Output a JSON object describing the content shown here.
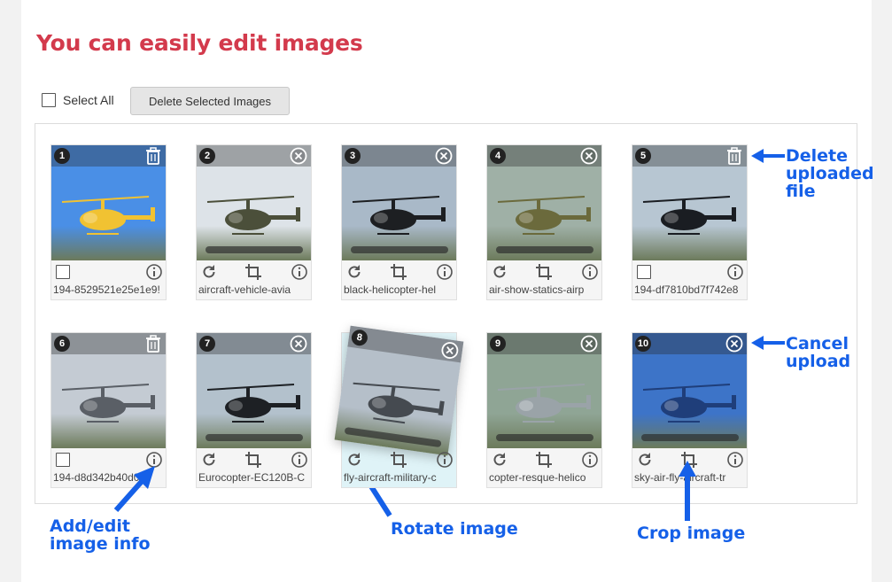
{
  "headline": "You can easily edit images",
  "select_all_label": "Select All",
  "delete_selected_label": "Delete Selected Images",
  "cards": [
    {
      "num": "1",
      "top_icon": "trash",
      "mode": "uploaded",
      "file": "194-8529521e25e1e9!",
      "sky": "#4a8fe6",
      "heli": "#f1c232"
    },
    {
      "num": "2",
      "top_icon": "cancel",
      "mode": "uploading",
      "file": "aircraft-vehicle-avia",
      "sky": "#dde3e8",
      "heli": "#4b4f3a"
    },
    {
      "num": "3",
      "top_icon": "cancel",
      "mode": "uploading",
      "file": "black-helicopter-hel",
      "sky": "#a9b9c8",
      "heli": "#1d1f22"
    },
    {
      "num": "4",
      "top_icon": "cancel",
      "mode": "uploading",
      "file": "air-show-statics-airp",
      "sky": "#9fb0a6",
      "heli": "#6b6a3c"
    },
    {
      "num": "5",
      "top_icon": "trash",
      "mode": "uploaded",
      "file": "194-df7810bd7f742e8",
      "sky": "#b7c6d2",
      "heli": "#1a1d22"
    },
    {
      "num": "6",
      "top_icon": "trash",
      "mode": "uploaded",
      "file": "194-d8d342b40d049",
      "sky": "#c4cbd3",
      "heli": "#5a5f66"
    },
    {
      "num": "7",
      "top_icon": "cancel",
      "mode": "uploading",
      "file": "Eurocopter-EC120B-C",
      "sky": "#b3c1cc",
      "heli": "#1d2024"
    },
    {
      "num": "8",
      "top_icon": "cancel",
      "mode": "uploading",
      "file": "fly-aircraft-military-c",
      "sky": "#b5bfc9",
      "heli": "#454a50"
    },
    {
      "num": "9",
      "top_icon": "cancel",
      "mode": "uploading",
      "file": "copter-resque-helico",
      "sky": "#8fa595",
      "heli": "#9aa3a8"
    },
    {
      "num": "10",
      "top_icon": "cancel",
      "mode": "uploading",
      "file": "sky-air-fly-aircraft-tr",
      "sky": "#3d74c8",
      "heli": "#1f3e7a"
    }
  ],
  "annotations": {
    "delete": "Delete\nuploaded\nfile",
    "cancel": "Cancel\nupload",
    "info": "Add/edit\nimage info",
    "rotate": "Rotate image",
    "crop": "Crop image"
  },
  "colors": {
    "accent_red": "#d33a4c",
    "annotation_blue": "#1560e8"
  }
}
